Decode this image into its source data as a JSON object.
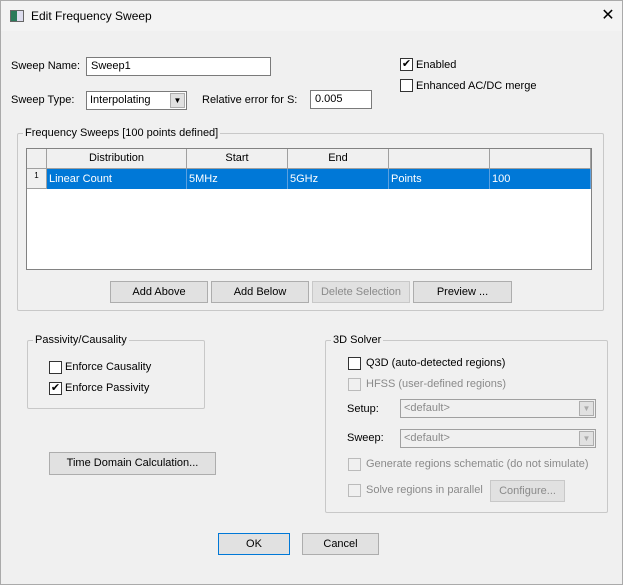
{
  "window": {
    "title": "Edit Frequency Sweep",
    "close": "✕"
  },
  "form": {
    "sweep_name_label": "Sweep Name:",
    "sweep_name": "Sweep1",
    "sweep_type_label": "Sweep Type:",
    "sweep_type": "Interpolating",
    "rel_error_label": "Relative error for S:",
    "rel_error": "0.005",
    "enabled_label": "Enabled",
    "enabled": true,
    "enhanced_label": "Enhanced AC/DC merge",
    "enhanced": false
  },
  "sweeps": {
    "legend": "Frequency Sweeps [100 points defined]",
    "columns": [
      "Distribution",
      "Start",
      "End",
      "",
      ""
    ],
    "rows": [
      {
        "num": "1",
        "cells": [
          "Linear Count",
          "5MHz",
          "5GHz",
          "Points",
          "100"
        ]
      }
    ],
    "buttons": {
      "add_above": "Add Above",
      "add_below": "Add Below",
      "delete": "Delete Selection",
      "preview": "Preview ..."
    }
  },
  "passivity": {
    "legend": "Passivity/Causality",
    "causality_label": "Enforce Causality",
    "causality": false,
    "passivity_label": "Enforce Passivity",
    "passivity": true
  },
  "time_domain_button": "Time Domain Calculation...",
  "solver": {
    "legend": "3D Solver",
    "q3d_label": "Q3D (auto-detected regions)",
    "hfss_label": "HFSS (user-defined regions)",
    "setup_label": "Setup:",
    "setup_value": "<default>",
    "sweep_label": "Sweep:",
    "sweep_value": "<default>",
    "generate_label": "Generate regions schematic (do not simulate)",
    "parallel_label": "Solve regions in parallel",
    "configure": "Configure..."
  },
  "footer": {
    "ok": "OK",
    "cancel": "Cancel"
  },
  "colors": {
    "selection": "#0078d7"
  }
}
